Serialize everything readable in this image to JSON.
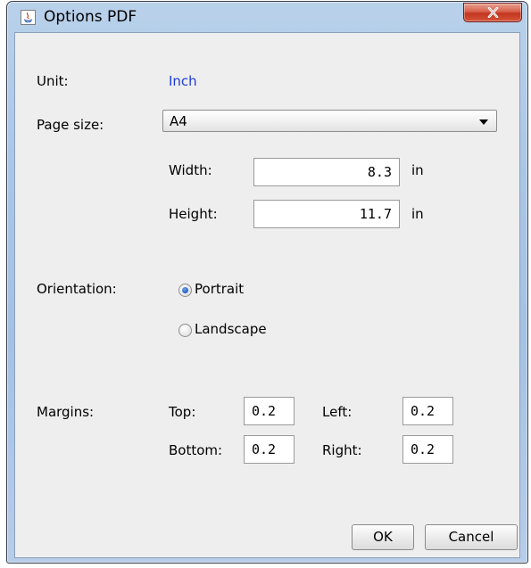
{
  "window": {
    "title": "Options PDF"
  },
  "unit": {
    "label": "Unit:",
    "value": "Inch"
  },
  "page_size": {
    "label": "Page size:",
    "selected": "A4",
    "width_label": "Width:",
    "width_value": "8.3",
    "width_unit": "in",
    "height_label": "Height:",
    "height_value": "11.7",
    "height_unit": "in"
  },
  "orientation": {
    "label": "Orientation:",
    "options": [
      "Portrait",
      "Landscape"
    ],
    "selected": "Portrait"
  },
  "margins": {
    "label": "Margins:",
    "top_label": "Top:",
    "top_value": "0.2",
    "left_label": "Left:",
    "left_value": "0.2",
    "bottom_label": "Bottom:",
    "bottom_value": "0.2",
    "right_label": "Right:",
    "right_value": "0.2"
  },
  "buttons": {
    "ok": "OK",
    "cancel": "Cancel"
  },
  "icons": {
    "window": "java-app-icon",
    "close": "close-icon"
  },
  "colors": {
    "unit_value": "#1f3cd6",
    "radio_selected": "#1f5ec2"
  }
}
